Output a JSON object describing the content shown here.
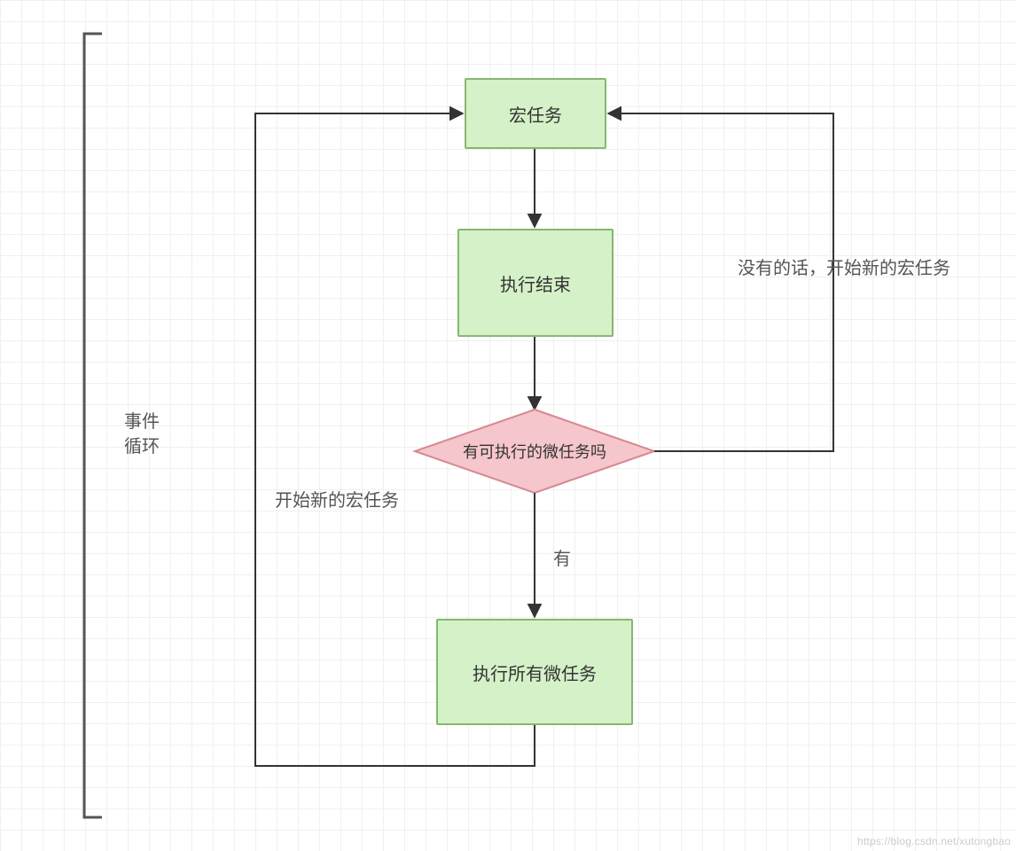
{
  "diagram": {
    "title_line1": "事件",
    "title_line2": "循环",
    "nodes": {
      "macrotask": "宏任务",
      "finish": "执行结束",
      "decision": "有可执行的微任务吗",
      "runMicro": "执行所有微任务"
    },
    "edges": {
      "left_up": "开始新的宏任务",
      "right_up": "没有的话，开始新的宏任务",
      "yes": "有"
    }
  },
  "watermark": "https://blog.csdn.net/xutongbao"
}
